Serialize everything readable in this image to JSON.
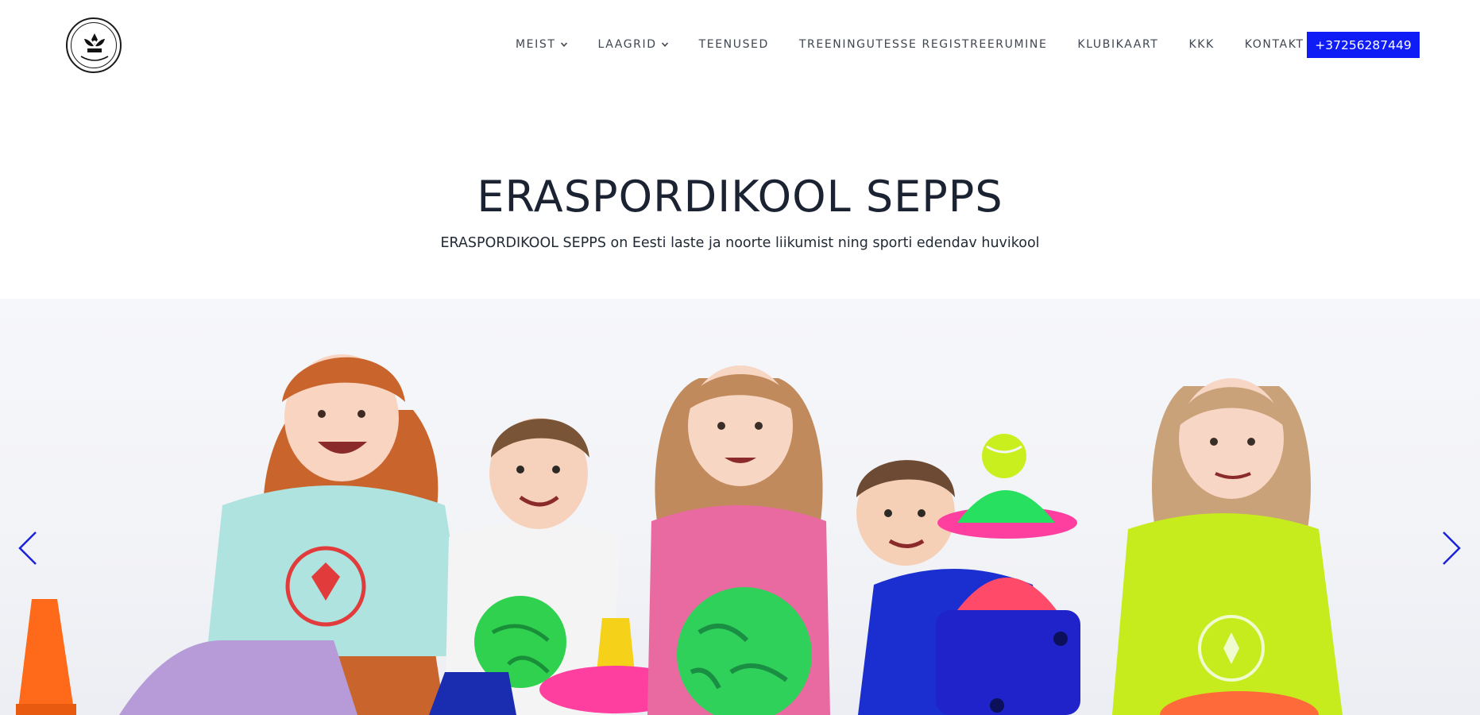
{
  "header": {
    "logo_icon": "sepps-logo-icon",
    "nav": [
      {
        "label": "MEIST",
        "has_dropdown": true
      },
      {
        "label": "LAAGRID",
        "has_dropdown": true
      },
      {
        "label": "TEENUSED",
        "has_dropdown": false
      },
      {
        "label": "TREENINGUTESSE REGISTREERUMINE",
        "has_dropdown": false
      },
      {
        "label": "KLUBIKAART",
        "has_dropdown": false
      },
      {
        "label": "KKK",
        "has_dropdown": false
      },
      {
        "label": "KONTAKT",
        "has_dropdown": false
      }
    ],
    "phone_label": "+37256287449"
  },
  "hero": {
    "title": "ERASPORDIKOOL SEPPS",
    "subtitle": "ERASPORDIKOOL SEPPS on Eesti laste ja noorte liikumist ning sporti edendav huvikool"
  },
  "slider": {
    "prev_icon": "chevron-left-icon",
    "next_icon": "chevron-right-icon"
  },
  "colors": {
    "accent": "#0f1cf5",
    "text_dark": "#1b2333",
    "nav_text": "#3f4650"
  }
}
